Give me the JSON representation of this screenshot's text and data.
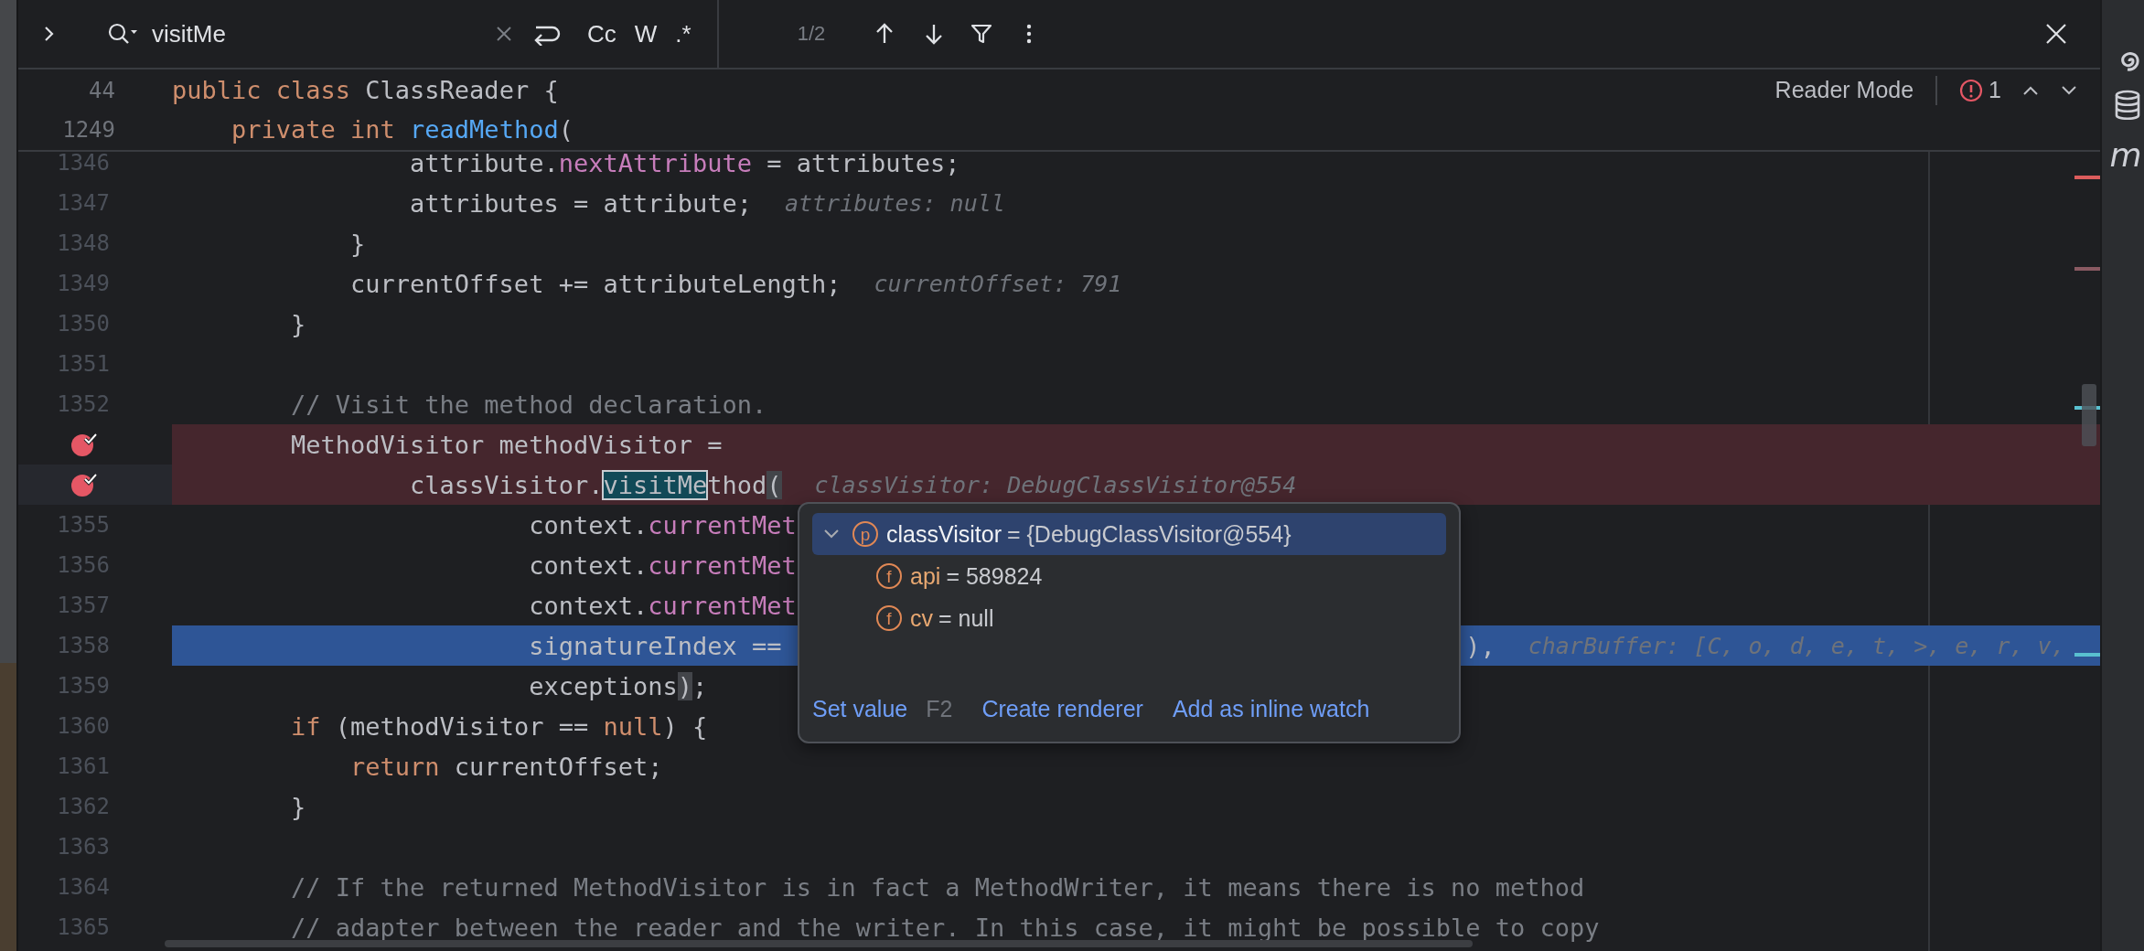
{
  "search_bar": {
    "query": "visitMe",
    "options": [
      {
        "label": "Cc",
        "selected": false
      },
      {
        "label": "W",
        "selected": false
      },
      {
        "label": ".*",
        "selected": false
      }
    ],
    "match_count": "1/2"
  },
  "editor_toolbar": {
    "reader_mode": "Reader Mode",
    "problems_count": "1"
  },
  "sticky_lines": [
    {
      "number": "44",
      "tokens": [
        {
          "kind": "keyword",
          "text": "public class "
        },
        {
          "kind": "plain",
          "text": "ClassReader {"
        }
      ]
    },
    {
      "number": "1249",
      "tokens": [
        {
          "kind": "keyword",
          "text": "    private int "
        },
        {
          "kind": "method",
          "text": "readMethod"
        },
        {
          "kind": "plain",
          "text": "("
        }
      ]
    }
  ],
  "lines": [
    {
      "number": "1346",
      "breakpoint": false,
      "execution": false,
      "caret": false,
      "tokens": [
        {
          "kind": "plain",
          "text": "                attribute."
        },
        {
          "kind": "field",
          "text": "nextAttribute"
        },
        {
          "kind": "plain",
          "text": " = attributes;"
        }
      ]
    },
    {
      "number": "1347",
      "breakpoint": false,
      "execution": false,
      "caret": false,
      "tokens": [
        {
          "kind": "plain",
          "text": "                attributes = attribute;"
        }
      ],
      "hint": "attributes: null"
    },
    {
      "number": "1348",
      "breakpoint": false,
      "execution": false,
      "caret": false,
      "tokens": [
        {
          "kind": "plain",
          "text": "            }"
        }
      ]
    },
    {
      "number": "1349",
      "breakpoint": false,
      "execution": false,
      "caret": false,
      "tokens": [
        {
          "kind": "plain",
          "text": "            currentOffset += attributeLength;"
        }
      ],
      "hint": "currentOffset: 791"
    },
    {
      "number": "1350",
      "breakpoint": false,
      "execution": false,
      "caret": false,
      "tokens": [
        {
          "kind": "plain",
          "text": "        }"
        }
      ]
    },
    {
      "number": "1351",
      "breakpoint": false,
      "execution": false,
      "caret": false
    },
    {
      "number": "1352",
      "breakpoint": false,
      "execution": false,
      "caret": false,
      "tokens": [
        {
          "kind": "comment",
          "text": "        // Visit the method declaration."
        }
      ]
    },
    {
      "breakpoint": true,
      "execution": false,
      "caret": false,
      "tokens": [
        {
          "kind": "plain",
          "text": "        MethodVisitor methodVisitor ="
        }
      ]
    },
    {
      "breakpoint": true,
      "execution": false,
      "caret": true,
      "tokens": [
        {
          "kind": "plain",
          "text": "                classVisitor."
        },
        {
          "kind": "match",
          "text": "visitMe"
        },
        {
          "kind": "plain",
          "text": "thod"
        },
        {
          "kind": "brace",
          "text": "("
        }
      ],
      "hint": "classVisitor: DebugClassVisitor@554"
    },
    {
      "number": "1355",
      "breakpoint": false,
      "execution": false,
      "caret": false,
      "tokens": [
        {
          "kind": "plain",
          "text": "                        context."
        },
        {
          "kind": "field",
          "text": "currentMet"
        }
      ]
    },
    {
      "number": "1356",
      "breakpoint": false,
      "execution": false,
      "caret": false,
      "tokens": [
        {
          "kind": "plain",
          "text": "                        context."
        },
        {
          "kind": "field",
          "text": "currentMet"
        }
      ]
    },
    {
      "number": "1357",
      "breakpoint": false,
      "execution": false,
      "caret": false,
      "tokens": [
        {
          "kind": "plain",
          "text": "                        context."
        },
        {
          "kind": "field",
          "text": "currentMet"
        }
      ]
    },
    {
      "number": "1358",
      "breakpoint": false,
      "execution": true,
      "caret": false,
      "tokens": [
        {
          "kind": "plain",
          "text": "                        signatureIndex =="
        }
      ],
      "tail": "),",
      "hint": "charBuffer: [C, o, d, e, t, >, e, r, v,"
    },
    {
      "number": "1359",
      "breakpoint": false,
      "execution": false,
      "caret": false,
      "tokens": [
        {
          "kind": "plain",
          "text": "                        exceptions"
        },
        {
          "kind": "brace",
          "text": ")"
        },
        {
          "kind": "plain",
          "text": ";"
        }
      ]
    },
    {
      "number": "1360",
      "breakpoint": false,
      "execution": false,
      "caret": false,
      "tokens": [
        {
          "kind": "keyword",
          "text": "        if"
        },
        {
          "kind": "plain",
          "text": " (methodVisitor == "
        },
        {
          "kind": "keyword",
          "text": "null"
        },
        {
          "kind": "plain",
          "text": ") {"
        }
      ]
    },
    {
      "number": "1361",
      "breakpoint": false,
      "execution": false,
      "caret": false,
      "tokens": [
        {
          "kind": "keyword",
          "text": "            return"
        },
        {
          "kind": "plain",
          "text": " currentOffset;"
        }
      ]
    },
    {
      "number": "1362",
      "breakpoint": false,
      "execution": false,
      "caret": false,
      "tokens": [
        {
          "kind": "plain",
          "text": "        }"
        }
      ]
    },
    {
      "number": "1363",
      "breakpoint": false,
      "execution": false,
      "caret": false
    },
    {
      "number": "1364",
      "breakpoint": false,
      "execution": false,
      "caret": false,
      "tokens": [
        {
          "kind": "comment",
          "text": "        // If the returned MethodVisitor is in fact a MethodWriter, it means there is no method"
        }
      ]
    },
    {
      "number": "1365",
      "breakpoint": false,
      "execution": false,
      "caret": false,
      "tokens": [
        {
          "kind": "comment",
          "text": "        // adapter between the reader and the writer. In this case, it might be possible to copy"
        }
      ]
    }
  ],
  "value_popup": {
    "tree": [
      {
        "kind": "parameter",
        "badge": "p",
        "name": "classVisitor",
        "value": "= {DebugClassVisitor@554}",
        "expanded": true,
        "selected": true,
        "children": [
          {
            "kind": "field",
            "badge": "f",
            "name": "api",
            "value": "= 589824",
            "selected": false
          },
          {
            "kind": "field",
            "badge": "f",
            "name": "cv",
            "value": "= null",
            "selected": false
          }
        ]
      }
    ],
    "actions": [
      {
        "label": "Set value",
        "shortcut": "F2"
      },
      {
        "label": "Create renderer"
      },
      {
        "label": "Add as inline watch"
      }
    ]
  },
  "tool_strip": {
    "label": "m"
  }
}
